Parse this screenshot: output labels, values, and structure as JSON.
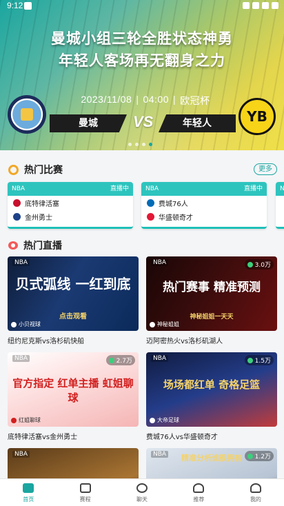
{
  "status_bar": {
    "time": "9:12"
  },
  "banner": {
    "headline_line1": "曼城小组三轮全胜状态神勇",
    "headline_line2": "年轻人客场再无翻身之力",
    "date": "2023/11/08",
    "time": "04:00",
    "competition": "欧冠杯",
    "home_team": "曼城",
    "away_team": "年轻人",
    "home_badge_text": "MANCHESTER CITY",
    "away_badge_text": "YB",
    "vs": "VS",
    "carousel_index": 4,
    "carousel_count": 4
  },
  "hot_matches": {
    "title": "热门比赛",
    "more": "更多",
    "cards": [
      {
        "league": "NBA",
        "status": "直播中",
        "home": "底特律活塞",
        "away": "金州勇士"
      },
      {
        "league": "NBA",
        "status": "直播中",
        "home": "费城76人",
        "away": "华盛顿奇才"
      },
      {
        "league": "NB",
        "status": "",
        "home": "",
        "away": ""
      }
    ]
  },
  "hot_live": {
    "title": "热门直播",
    "items": [
      {
        "tag": "NBA",
        "views": "",
        "headline": "贝式弧线 一红到底",
        "sub": "点击观看",
        "anchor": "小贝视球",
        "title": "纽约尼克斯vs洛杉矶快船"
      },
      {
        "tag": "NBA",
        "views": "3.0万",
        "headline": "热门赛事 精准预测",
        "sub": "神秘姐姐一天天",
        "anchor": "神秘姐姐",
        "title": "迈阿密热火vs洛杉矶湖人"
      },
      {
        "tag": "NBA",
        "views": "2.7万",
        "headline": "官方指定 红单主播 虹姐聊球",
        "sub": "",
        "anchor": "红姐聊球",
        "title": "底特律活塞vs金州勇士"
      },
      {
        "tag": "NBA",
        "views": "1.5万",
        "headline": "场场都红单 奇格足篮",
        "sub": "",
        "anchor": "大帝足球",
        "title": "费城76人vs华盛顿奇才"
      },
      {
        "tag": "NBA",
        "views": "",
        "headline": "",
        "sub": "",
        "anchor": "",
        "title": ""
      },
      {
        "tag": "NBA",
        "views": "1.2万",
        "headline": "精准分析谁很拥有",
        "sub": "",
        "anchor": "",
        "title": ""
      }
    ]
  },
  "bottom_nav": [
    {
      "label": "首页",
      "icon": "home-icon",
      "active": true
    },
    {
      "label": "赛程",
      "icon": "calendar-icon",
      "active": false
    },
    {
      "label": "聊天",
      "icon": "chat-icon",
      "active": false
    },
    {
      "label": "推荐",
      "icon": "expert-icon",
      "active": false
    },
    {
      "label": "我的",
      "icon": "profile-icon",
      "active": false
    }
  ],
  "colors": {
    "accent": "#1aa6a0",
    "card_header": "#2ec4be",
    "hot": "#f2a827",
    "live": "#f25a5a"
  }
}
